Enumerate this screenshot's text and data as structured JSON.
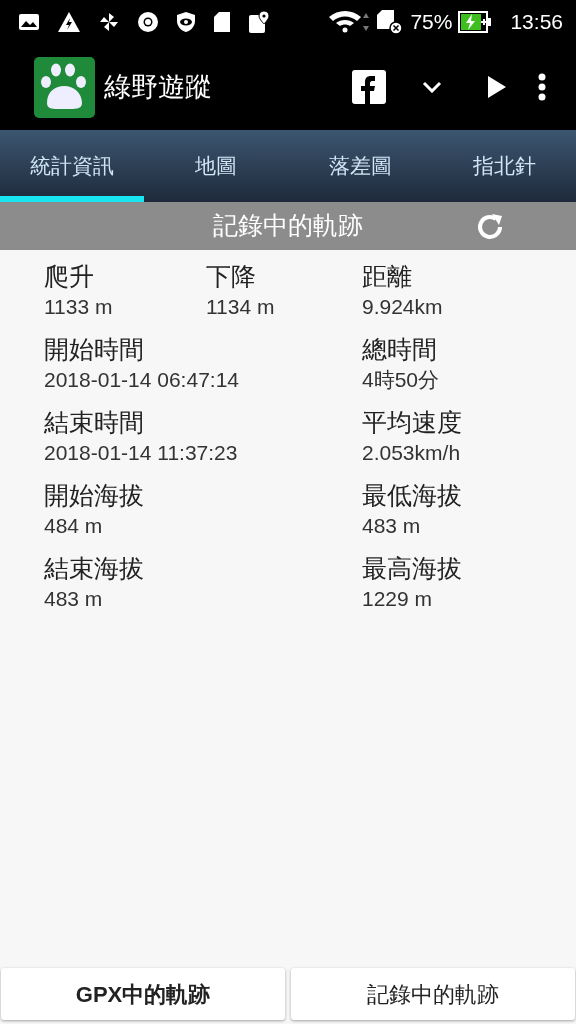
{
  "status_bar": {
    "battery": "75%",
    "time": "13:56"
  },
  "app_bar": {
    "title": "綠野遊蹤"
  },
  "tabs": [
    {
      "label": "統計資訊",
      "selected": true
    },
    {
      "label": "地圖",
      "selected": false
    },
    {
      "label": "落差圖",
      "selected": false
    },
    {
      "label": "指北針",
      "selected": false
    }
  ],
  "section_header": {
    "title": "記錄中的軌跡"
  },
  "stats": [
    {
      "label": "爬升",
      "value": "1133 m",
      "kind": "narrow"
    },
    {
      "label": "下降",
      "value": "1134 m",
      "kind": "narrow"
    },
    {
      "label": "距離",
      "value": "9.924km",
      "kind": "narrow"
    },
    {
      "label": "開始時間",
      "value": "2018-01-14 06:47:14",
      "kind": "wide"
    },
    {
      "label": "總時間",
      "value": "4時50分",
      "kind": "narrow"
    },
    {
      "label": "結束時間",
      "value": "2018-01-14 11:37:23",
      "kind": "wide"
    },
    {
      "label": "平均速度",
      "value": "2.053km/h",
      "kind": "narrow"
    },
    {
      "label": "開始海拔",
      "value": "484 m",
      "kind": "wide"
    },
    {
      "label": "最低海拔",
      "value": "483 m",
      "kind": "narrow"
    },
    {
      "label": "結束海拔",
      "value": "483 m",
      "kind": "wide"
    },
    {
      "label": "最高海拔",
      "value": "1229 m",
      "kind": "narrow"
    }
  ],
  "buttons": [
    {
      "label": "GPX中的軌跡",
      "bold": true
    },
    {
      "label": "記錄中的軌跡",
      "bold": false
    }
  ]
}
